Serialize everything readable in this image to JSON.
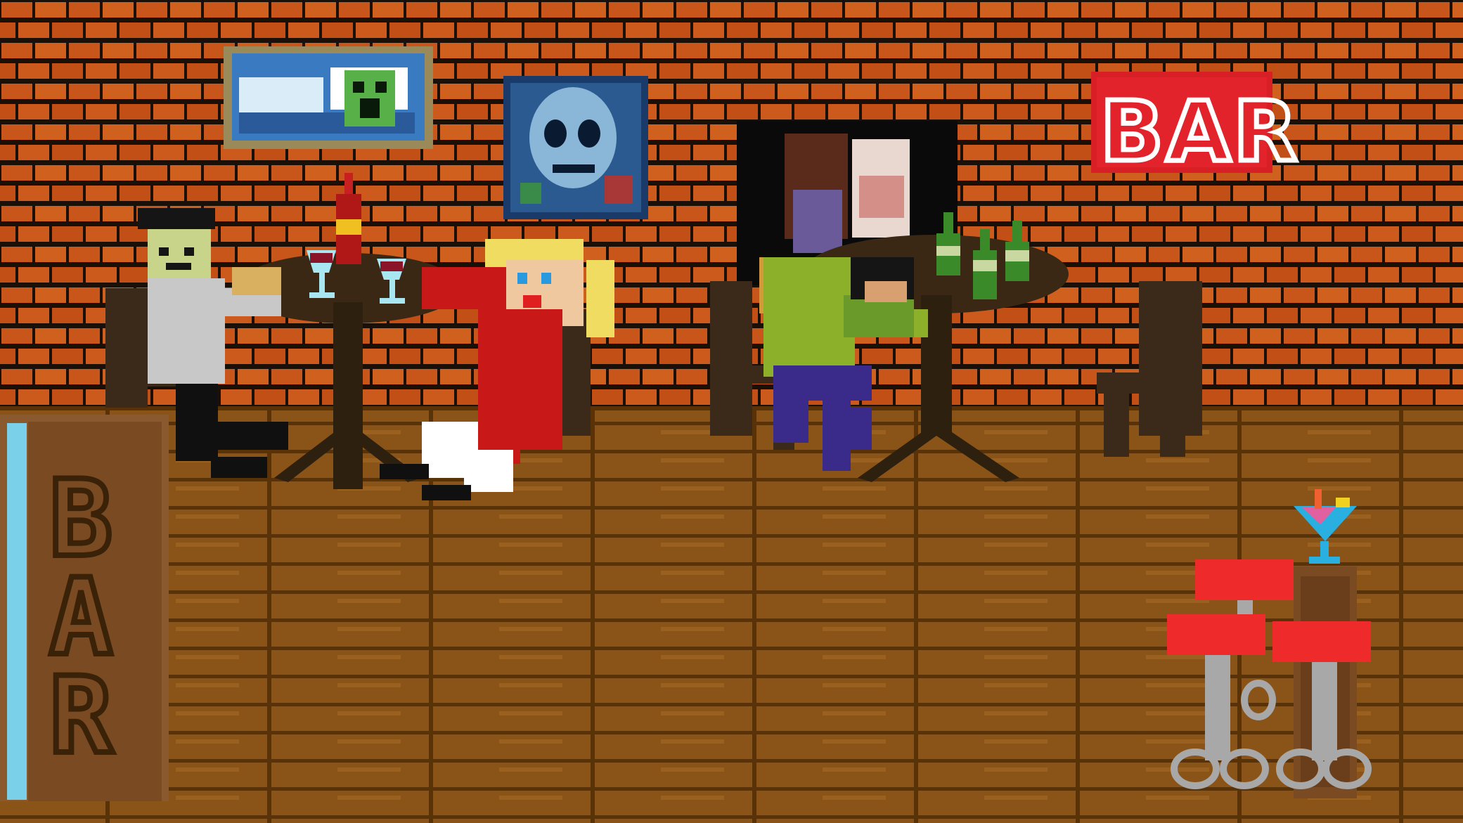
{
  "scene": {
    "neon_sign_text": "BAR",
    "bar_counter_text": "BAR"
  },
  "colors": {
    "brick": "#c8561a",
    "mortar": "#1a1008",
    "floor": "#8a5318",
    "floor_line": "#5a3208",
    "table": "#3a2815",
    "chair": "#3b2a1a",
    "neon_red": "#e3232b",
    "stool_seat": "#ee2a2a",
    "stool_metal": "#a8a8a8"
  },
  "icons": [
    "neon-bar-sign",
    "minecraft-painting",
    "skull-painting",
    "couple-portrait",
    "wine-bottle",
    "wine-glass",
    "green-bottle",
    "cocktail-glass",
    "bar-stool"
  ]
}
